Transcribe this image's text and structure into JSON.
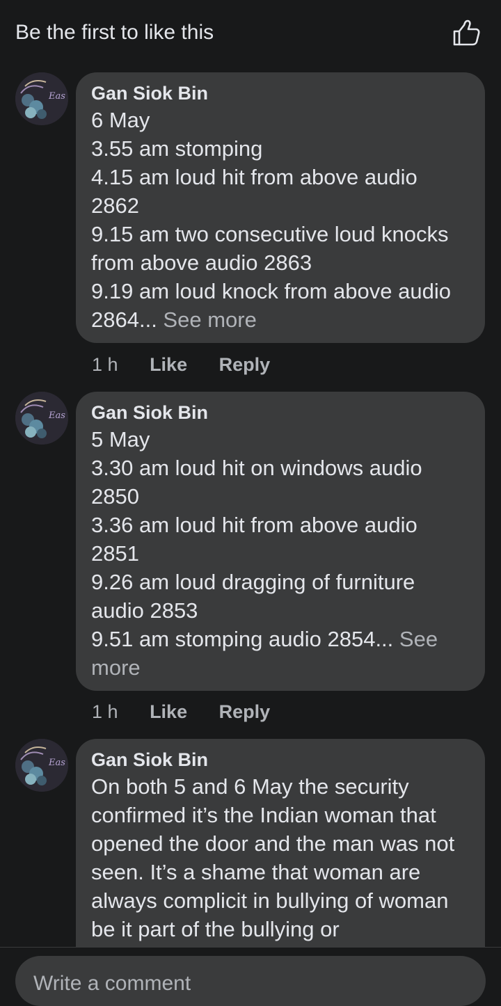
{
  "header": {
    "title": "Be the first to like this"
  },
  "comments": [
    {
      "author": "Gan Siok Bin",
      "text": "6 May\n3.55 am stomping\n4.15 am loud hit from above audio 2862\n9.15 am two consecutive loud knocks from above audio 2863\n9.19 am loud knock from above audio 2864...",
      "see_more": " See more",
      "time": "1 h",
      "like": "Like",
      "reply": "Reply"
    },
    {
      "author": "Gan Siok Bin",
      "text": "5 May\n3.30 am loud hit on windows audio 2850\n3.36 am loud hit from above audio 2851\n9.26 am loud dragging of furniture audio 2853\n9.51 am stomping audio 2854...",
      "see_more": " See more",
      "time": "1 h",
      "like": "Like",
      "reply": "Reply"
    },
    {
      "author": "Gan Siok Bin",
      "text": "On both 5 and 6 May the security confirmed it’s the Indian woman that opened the door and the man was not seen. It’s a shame that woman are always complicit in bullying of woman be it part of the bullying or"
    }
  ],
  "footer": {
    "placeholder": "Write a comment"
  }
}
